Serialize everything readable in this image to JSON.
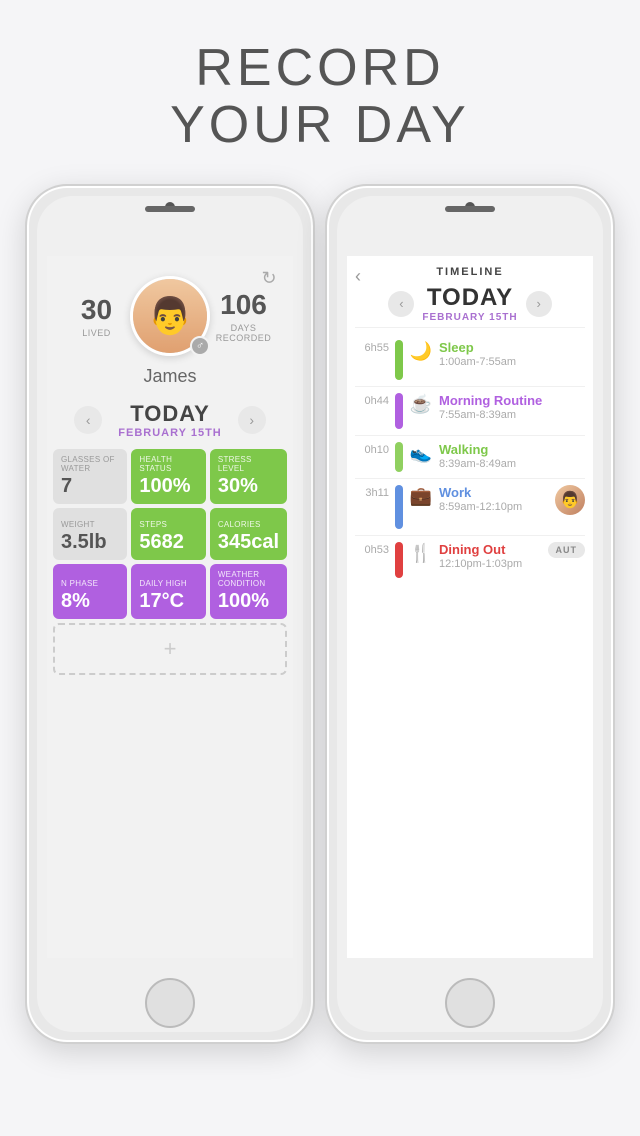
{
  "header": {
    "line1": "RECORD",
    "line2": "YOUR DAY"
  },
  "left_phone": {
    "refresh_icon": "↻",
    "profile": {
      "stat_left_number": "30",
      "stat_left_label": "LIVED",
      "stat_right_number": "106",
      "stat_right_label": "DAYS RECORDED",
      "name": "James",
      "gender_icon": "♂"
    },
    "today": {
      "label": "TODAY",
      "date": "FEBRUARY 15TH"
    },
    "nav": {
      "left": "‹",
      "right": "›"
    },
    "stats": [
      {
        "label": "GLASSES OF WATER",
        "value": "7",
        "color": "gray"
      },
      {
        "label": "HEALTH STATUS",
        "value": "100%",
        "color": "green"
      },
      {
        "label": "STRESS LEVEL",
        "value": "30%",
        "color": "green"
      },
      {
        "label": "WEIGHT",
        "value": "3.5lb",
        "color": "gray"
      },
      {
        "label": "STEPS",
        "value": "5682",
        "color": "green"
      },
      {
        "label": "CALORIES",
        "value": "345cal",
        "color": "green"
      },
      {
        "label": "N PHASE",
        "value": "8%",
        "color": "purple"
      },
      {
        "label": "DAILY HIGH",
        "value": "17°C",
        "color": "purple"
      },
      {
        "label": "WEATHER CONDITION",
        "value": "100%",
        "color": "purple"
      }
    ],
    "add_icon": "+"
  },
  "right_phone": {
    "back_icon": "‹",
    "timeline_label": "TIMELINE",
    "today": {
      "label": "TODAY",
      "date": "FEBRUARY 15TH"
    },
    "nav": {
      "left": "‹",
      "right": "›"
    },
    "entries": [
      {
        "duration": "6h55",
        "bar_color": "bar-green",
        "icon": "🌙",
        "title": "Sleep",
        "title_color": "title-green",
        "time": "1:00am-7:55am"
      },
      {
        "duration": "0h44",
        "bar_color": "bar-purple",
        "icon": "☕",
        "title": "Morning Routine",
        "title_color": "title-purple",
        "time": "7:55am-8:39am"
      },
      {
        "duration": "0h10",
        "bar_color": "bar-green2",
        "icon": "👟",
        "title": "Walking",
        "title_color": "title-green",
        "time": "8:39am-8:49am"
      },
      {
        "duration": "3h11",
        "bar_color": "bar-blue",
        "icon": "💼",
        "title": "Work",
        "title_color": "title-blue",
        "time": "8:59am-12:10pm",
        "has_avatar": true
      },
      {
        "duration": "0h53",
        "bar_color": "bar-red",
        "icon": "🍴",
        "title": "Dining Out",
        "title_color": "title-red",
        "time": "12:10pm-1:03pm"
      }
    ],
    "auto_label": "AUT"
  }
}
